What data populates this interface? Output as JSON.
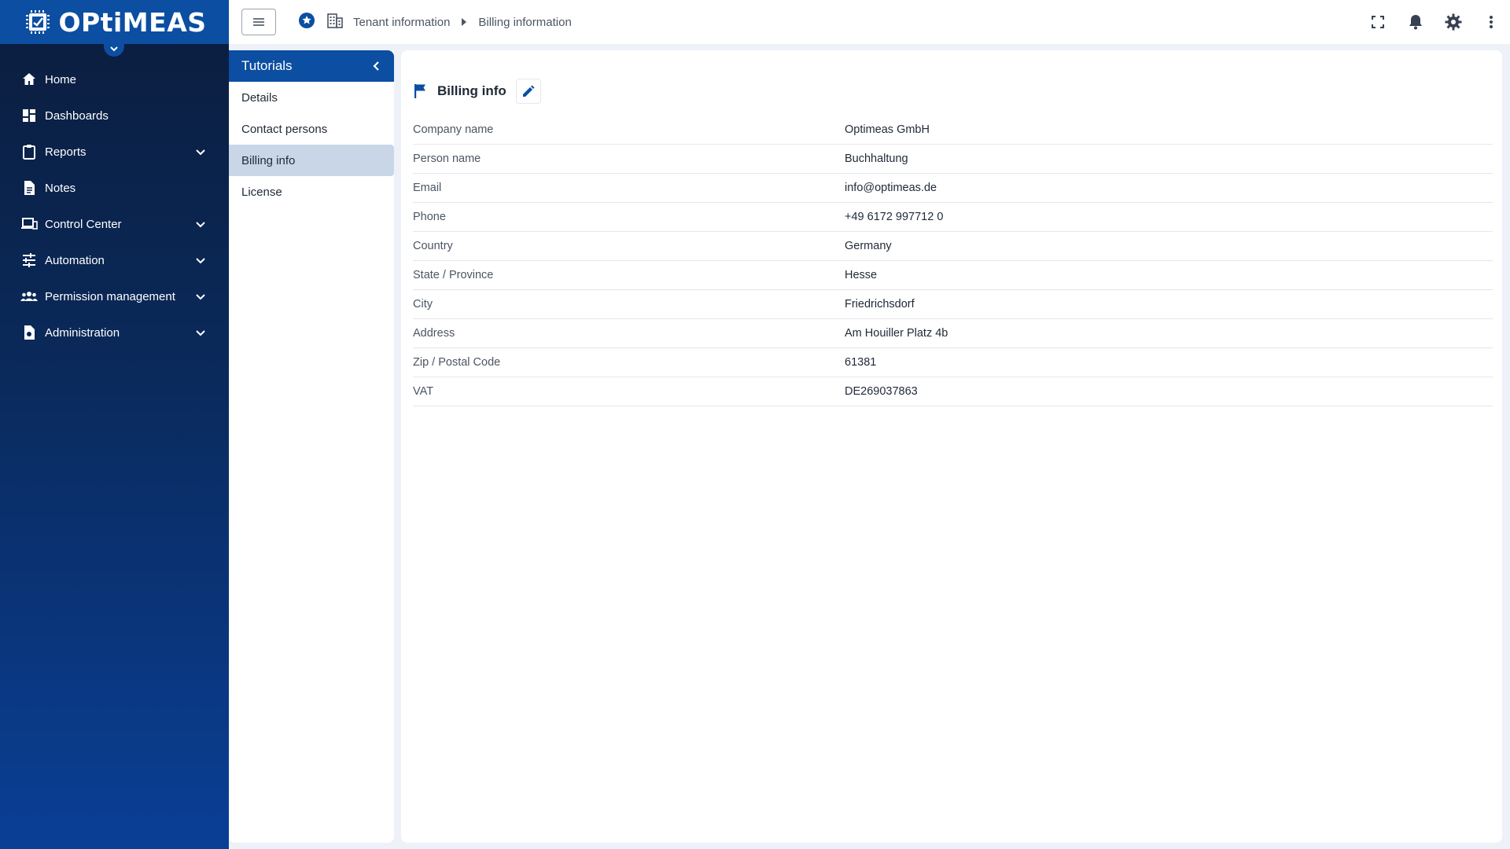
{
  "brand": {
    "name": "OPtiMEAS"
  },
  "sidebar": {
    "items": [
      {
        "label": "Home",
        "icon": "home-icon",
        "expandable": false
      },
      {
        "label": "Dashboards",
        "icon": "dashboard-icon",
        "expandable": false
      },
      {
        "label": "Reports",
        "icon": "clipboard-icon",
        "expandable": true
      },
      {
        "label": "Notes",
        "icon": "document-icon",
        "expandable": false
      },
      {
        "label": "Control Center",
        "icon": "devices-icon",
        "expandable": true
      },
      {
        "label": "Automation",
        "icon": "sliders-icon",
        "expandable": true
      },
      {
        "label": "Permission management",
        "icon": "people-icon",
        "expandable": true
      },
      {
        "label": "Administration",
        "icon": "admin-document-icon",
        "expandable": true
      }
    ]
  },
  "topbar": {
    "breadcrumb": {
      "first": "Tenant information",
      "second": "Billing information"
    }
  },
  "subpanel": {
    "title": "Tutorials",
    "items": [
      {
        "label": "Details",
        "active": false
      },
      {
        "label": "Contact persons",
        "active": false
      },
      {
        "label": "Billing info",
        "active": true
      },
      {
        "label": "License",
        "active": false
      }
    ]
  },
  "billing": {
    "title": "Billing info",
    "rows": [
      {
        "label": "Company name",
        "value": "Optimeas GmbH"
      },
      {
        "label": "Person name",
        "value": "Buchhaltung"
      },
      {
        "label": "Email",
        "value": "info@optimeas.de"
      },
      {
        "label": "Phone",
        "value": "+49 6172 997712 0"
      },
      {
        "label": "Country",
        "value": "Germany"
      },
      {
        "label": "State / Province",
        "value": "Hesse"
      },
      {
        "label": "City",
        "value": "Friedrichsdorf"
      },
      {
        "label": "Address",
        "value": "Am Houiller Platz 4b"
      },
      {
        "label": "Zip / Postal Code",
        "value": "61381"
      },
      {
        "label": "VAT",
        "value": "DE269037863"
      }
    ]
  },
  "colors": {
    "primary": "#0b4ea2",
    "sidebar_dark": "#0b1d3d",
    "active_item": "#c9d6e8"
  }
}
